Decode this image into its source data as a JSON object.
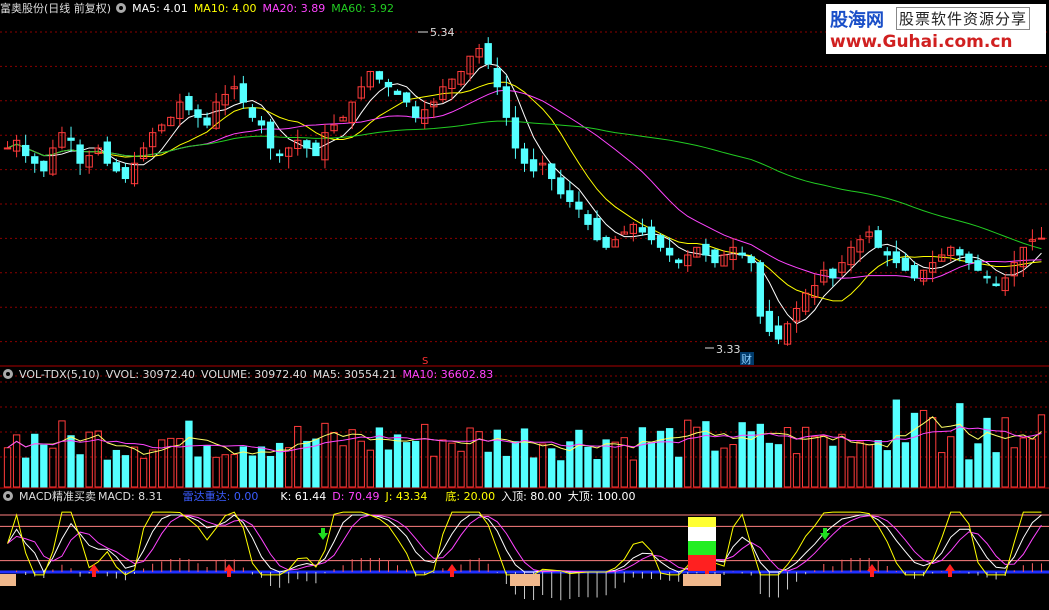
{
  "price_panel": {
    "title": "富奥股份(日线 前复权)",
    "ma5": "MA5: 4.01",
    "ma10": "MA10: 4.00",
    "ma20": "MA20: 3.89",
    "ma60": "MA60: 3.92",
    "high_label": "5.34",
    "low_label": "3.33",
    "marker_cai": "财",
    "marker_s": "S"
  },
  "volume_panel": {
    "name": "VOL-TDX(5,10)",
    "vvol": "VVOL: 30972.40",
    "volume": "VOLUME: 30972.40",
    "ma5": "MA5: 30554.21",
    "ma10": "MA10: 36602.83"
  },
  "macd_panel": {
    "name": "MACD精准买卖",
    "macd": "MACD: 8.31",
    "radar": "雷达重达: 0.00",
    "k": "K: 61.44",
    "d": "D: 70.49",
    "j": "J: 43.34",
    "bottom": "底: 20.00",
    "top_in": "入顶: 80.00",
    "top_big": "大顶: 100.00"
  },
  "logo": {
    "brand": "股海网",
    "tagline": "股票软件资源分享",
    "url": "www.Guhai.com.cn"
  },
  "colors": {
    "up": "#ff3b3b",
    "down": "#54ffff",
    "ma5": "#ffffff",
    "ma10": "#ffff00",
    "ma20": "#ff44ff",
    "ma60": "#22cc22",
    "grid": "#8b0000",
    "axis": "#aa0000"
  },
  "chart_data": {
    "type": "candlestick",
    "price_range": [
      3.2,
      5.45
    ],
    "price_high": 5.34,
    "price_low": 3.33,
    "ma_last": {
      "ma5": 4.01,
      "ma10": 4.0,
      "ma20": 3.89,
      "ma60": 3.92
    },
    "closes": [
      4.6,
      4.65,
      4.55,
      4.5,
      4.45,
      4.6,
      4.7,
      4.65,
      4.5,
      4.55,
      4.6,
      4.5,
      4.45,
      4.4,
      4.5,
      4.6,
      4.7,
      4.75,
      4.8,
      4.9,
      4.85,
      4.8,
      4.75,
      4.9,
      4.95,
      5.0,
      4.9,
      4.8,
      4.75,
      4.6,
      4.55,
      4.6,
      4.65,
      4.6,
      4.55,
      4.7,
      4.75,
      4.8,
      4.9,
      5.0,
      5.1,
      5.05,
      5.0,
      4.95,
      4.9,
      4.8,
      4.85,
      4.9,
      5.0,
      5.05,
      5.1,
      5.2,
      5.25,
      5.15,
      5.0,
      4.8,
      4.6,
      4.5,
      4.45,
      4.5,
      4.4,
      4.3,
      4.25,
      4.2,
      4.1,
      4.0,
      3.95,
      4.0,
      4.05,
      4.1,
      4.05,
      4.0,
      3.95,
      3.9,
      3.85,
      3.9,
      3.95,
      3.9,
      3.85,
      3.9,
      3.95,
      3.9,
      3.85,
      3.5,
      3.4,
      3.35,
      3.45,
      3.55,
      3.65,
      3.7,
      3.8,
      3.75,
      3.85,
      3.95,
      4.0,
      4.05,
      3.95,
      3.9,
      3.85,
      3.8,
      3.75,
      3.8,
      3.85,
      3.9,
      3.95,
      3.9,
      3.85,
      3.8,
      3.75,
      3.7,
      3.75,
      3.85,
      3.95,
      4.0,
      4.01
    ],
    "volume_range": [
      0,
      100000
    ],
    "volume_last": {
      "vvol": 30972.4,
      "volume": 30972.4,
      "ma5": 30554.21,
      "ma10": 36602.83
    },
    "macd_last": {
      "macd": 8.31,
      "k": 61.44,
      "d": 70.49,
      "j": 43.34
    },
    "macd_levels": {
      "bottom": 20.0,
      "top_in": 80.0,
      "top_big": 100.0
    }
  }
}
